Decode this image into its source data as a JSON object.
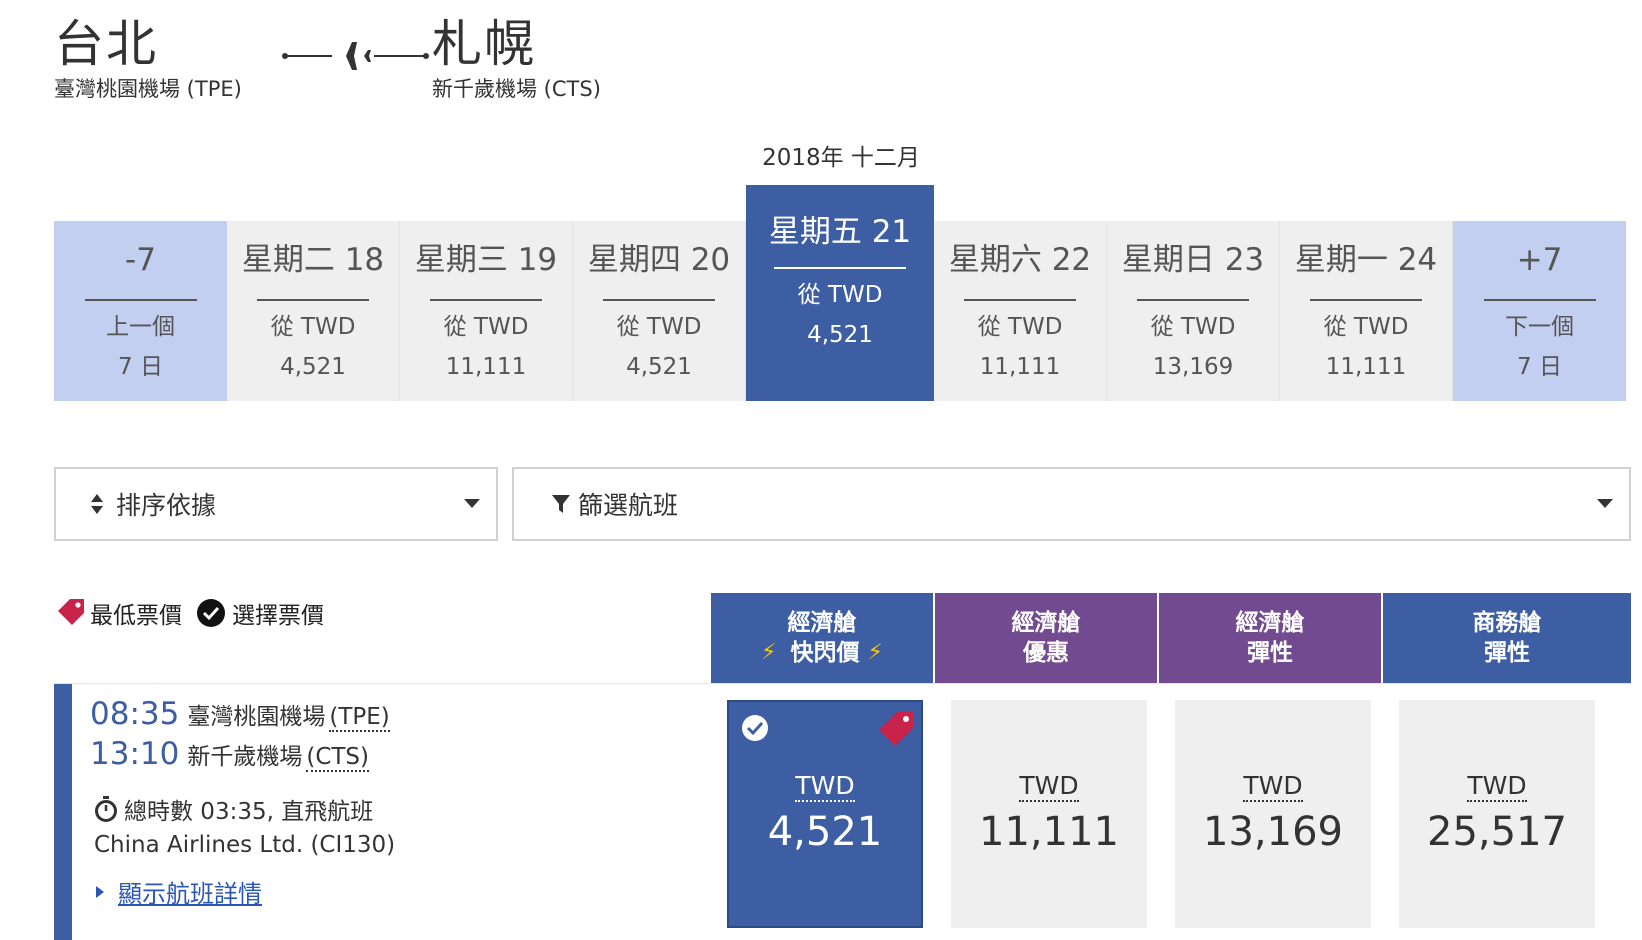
{
  "route": {
    "origin_city": "台北",
    "origin_airport": "臺灣桃園機場 (TPE)",
    "destination_city": "札幌",
    "destination_airport": "新千歲機場 (CTS)"
  },
  "month_label": "2018年 十二月",
  "date_strip": {
    "prev": {
      "top": "-7",
      "line1": "上一個",
      "line2": "7 日"
    },
    "days": [
      {
        "label": "星期二 18",
        "from": "從 TWD",
        "price": "4,521"
      },
      {
        "label": "星期三 19",
        "from": "從 TWD",
        "price": "11,111"
      },
      {
        "label": "星期四 20",
        "from": "從 TWD",
        "price": "4,521"
      },
      {
        "label": "星期五 21",
        "from": "從 TWD",
        "price": "4,521"
      },
      {
        "label": "星期六 22",
        "from": "從 TWD",
        "price": "11,111"
      },
      {
        "label": "星期日 23",
        "from": "從 TWD",
        "price": "13,169"
      },
      {
        "label": "星期一 24",
        "from": "從 TWD",
        "price": "11,111"
      }
    ],
    "next": {
      "top": "+7",
      "line1": "下一個",
      "line2": "7 日"
    },
    "selected_day": "星期五 21"
  },
  "controls": {
    "sort_label": "排序依據",
    "filter_label": "篩選航班"
  },
  "legend": {
    "lowest_fare": "最低票價",
    "selected_fare": "選擇票價"
  },
  "fare_columns": [
    {
      "line1": "經濟艙",
      "line2": "快閃價",
      "flash": true,
      "color": "#3d5ea2"
    },
    {
      "line1": "經濟艙",
      "line2": "優惠",
      "flash": false,
      "color": "#714a8f"
    },
    {
      "line1": "經濟艙",
      "line2": "彈性",
      "flash": false,
      "color": "#714a8f"
    },
    {
      "line1": "商務艙",
      "line2": "彈性",
      "flash": false,
      "color": "#3d5ea2"
    }
  ],
  "flight": {
    "depart_time": "08:35",
    "depart_airport": "臺灣桃園機場",
    "depart_code": "(TPE)",
    "arrive_time": "13:10",
    "arrive_airport": "新千歲機場",
    "arrive_code": "(CTS)",
    "duration": "總時數 03:35, 直飛航班",
    "airline": "China Airlines Ltd. (CI130)",
    "details_link": "顯示航班詳情",
    "prices": [
      {
        "currency": "TWD",
        "value": "4,521",
        "selected": true,
        "lowest": true
      },
      {
        "currency": "TWD",
        "value": "11,111",
        "selected": false,
        "lowest": false
      },
      {
        "currency": "TWD",
        "value": "13,169",
        "selected": false,
        "lowest": false
      },
      {
        "currency": "TWD",
        "value": "25,517",
        "selected": false,
        "lowest": false
      }
    ]
  },
  "colors": {
    "brand_blue": "#3d5ea2",
    "nav_light_blue": "#c3cff0",
    "purple": "#714a8f",
    "lowest_tag": "#c8234a",
    "flash_yellow": "#f5c518",
    "link_blue": "#2a56b8"
  },
  "icons": {
    "plane": "plane-icon",
    "sort": "sort-icon",
    "filter": "filter-icon",
    "tag": "price-tag-icon",
    "check": "check-circle-icon",
    "stopwatch": "stopwatch-icon",
    "flash": "lightning-icon",
    "caret": "caret-right-icon"
  }
}
